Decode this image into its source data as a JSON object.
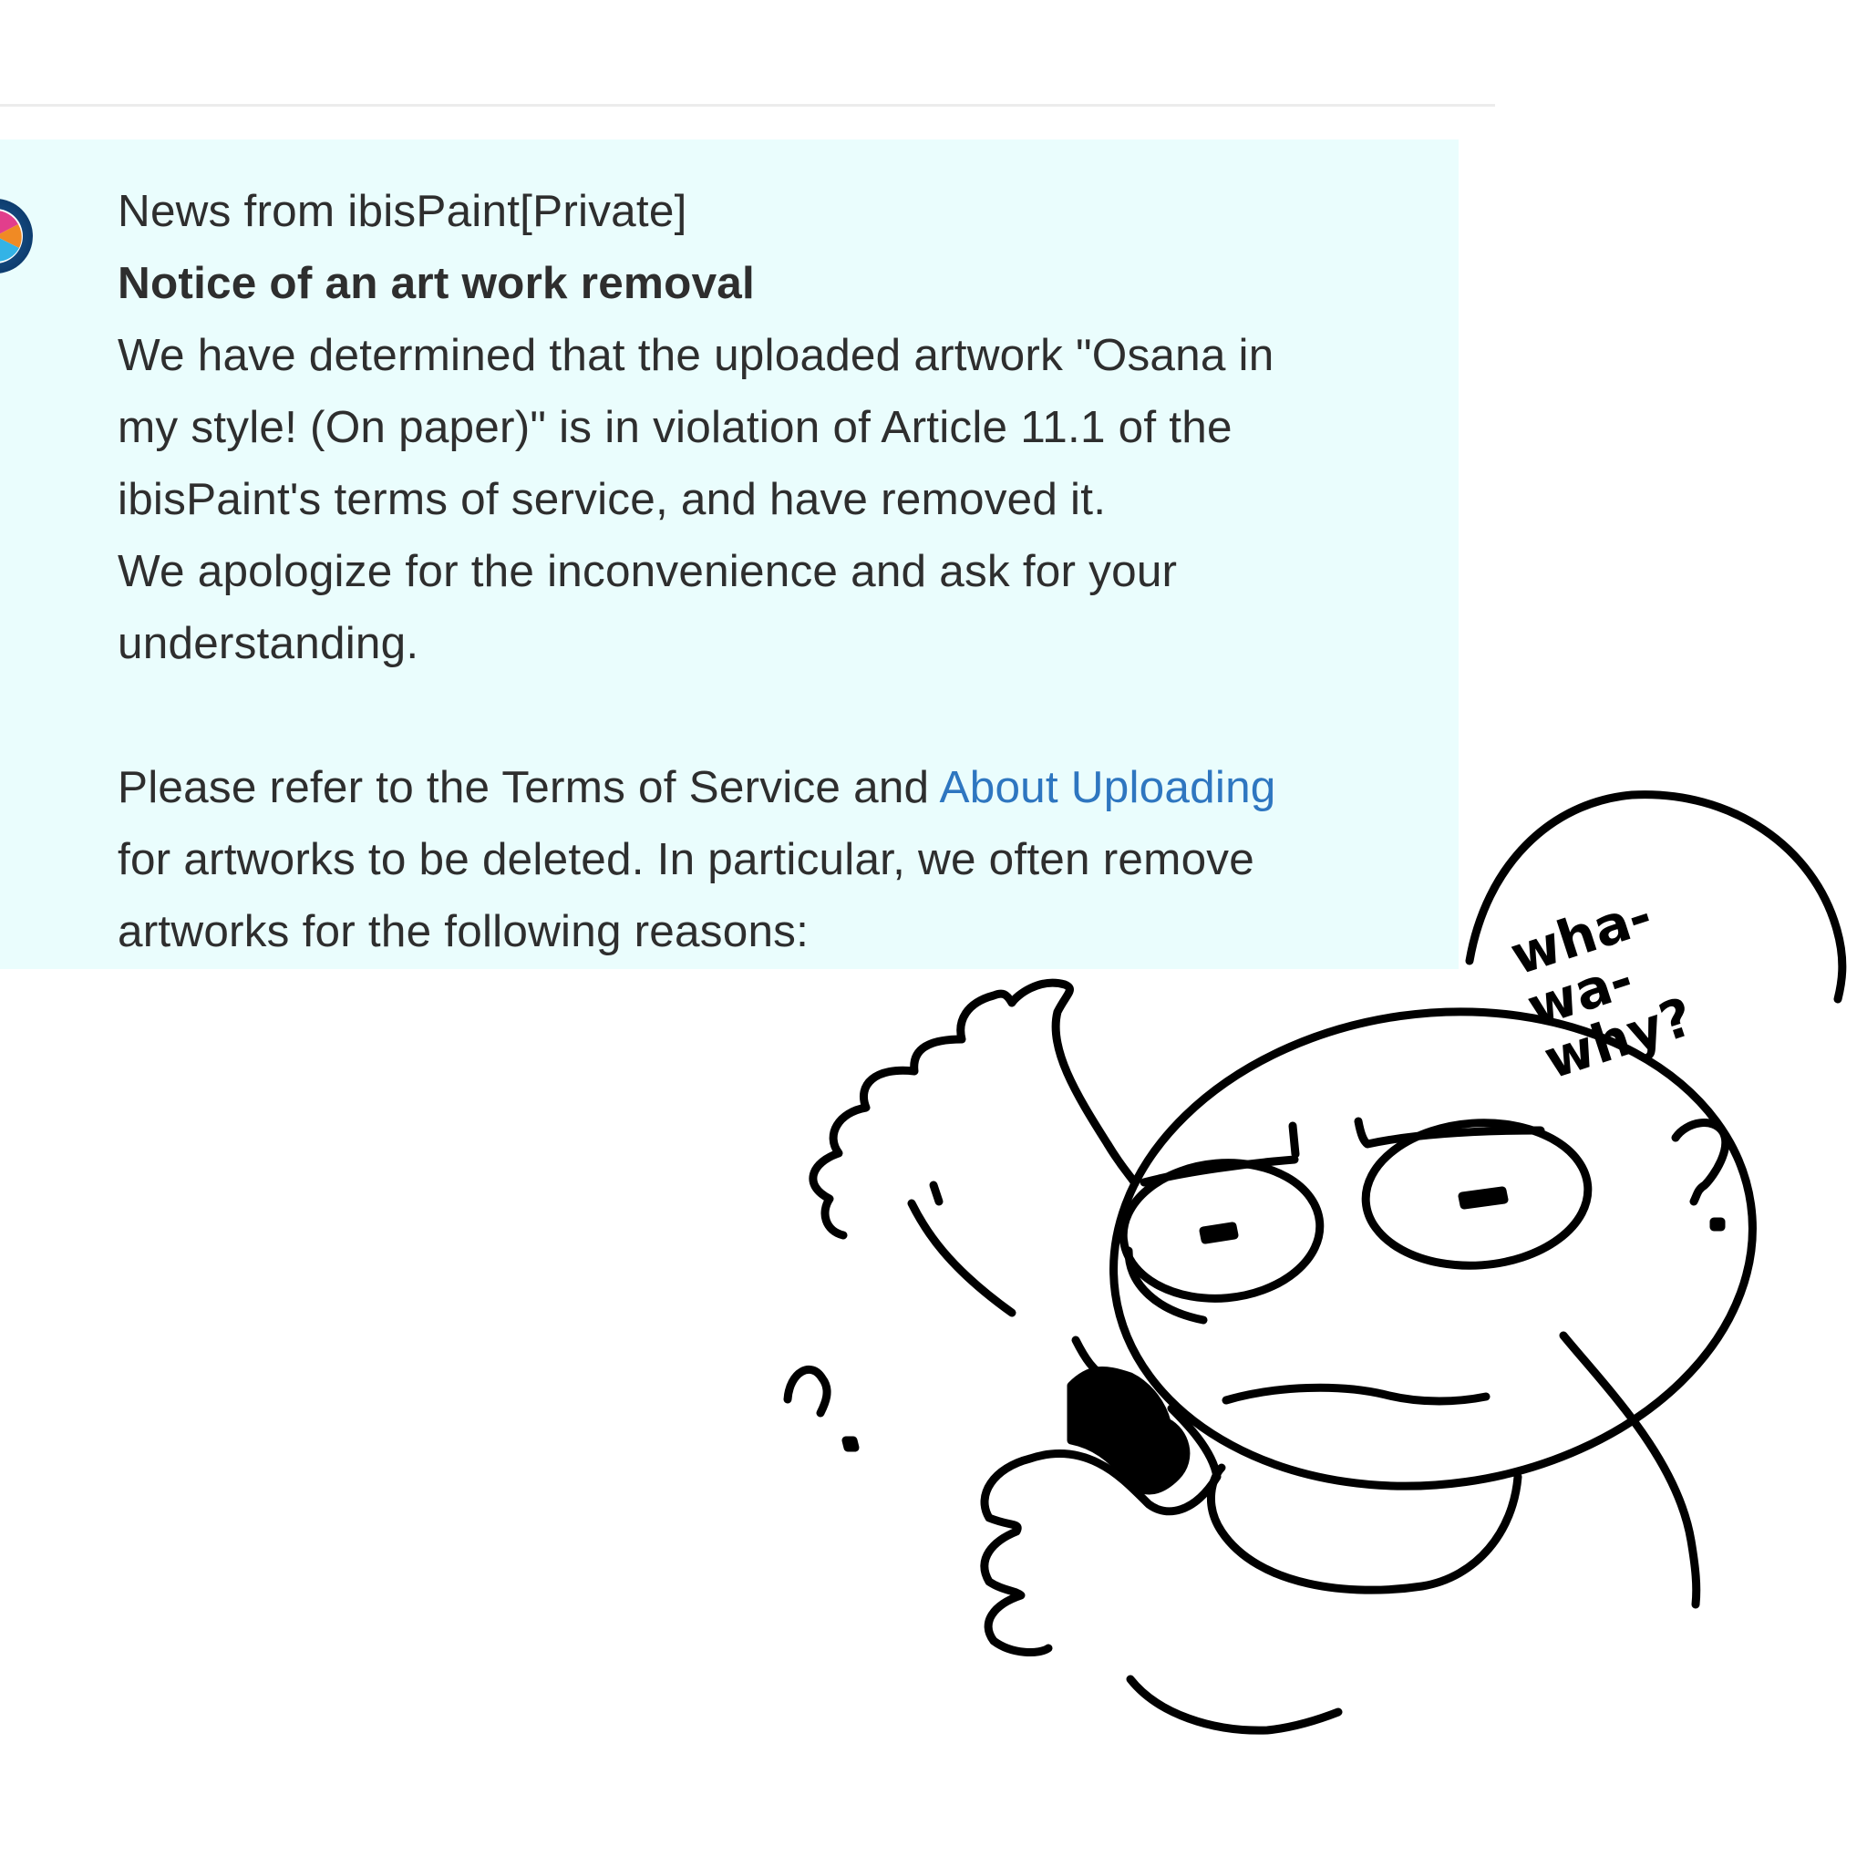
{
  "notice": {
    "sender": "News from ibisPaint[Private]",
    "title": "Notice of an art work removal",
    "body_lines": [
      "We have determined that the uploaded artwork \"Osana in",
      "my style! (On paper)\" is in violation of Article 11.1 of the",
      "ibisPaint's terms of service, and have removed it.",
      "We apologize for the inconvenience and ask for your",
      "understanding."
    ],
    "refer_prefix": "Please refer to the Terms of Service and ",
    "refer_link": "About Uploading",
    "refer_lines": [
      "for artworks to be deleted. In particular, we often remove",
      "artworks for the following reasons:"
    ]
  },
  "doodle": {
    "speech": "wha-\nwa-\nwhy?",
    "question_mark_right": "?",
    "question_mark_left": "?"
  },
  "colors": {
    "card_background": "#eafdfd",
    "text": "#2e2e2e",
    "link": "#2e76c0"
  },
  "icons": {
    "avatar": "ibispaint-logo-icon"
  }
}
